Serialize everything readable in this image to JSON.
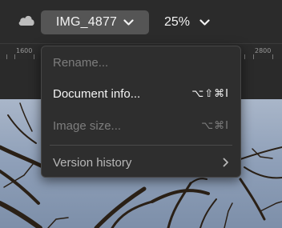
{
  "header": {
    "cloud_icon": "cloud-icon",
    "file_name": "IMG_4877",
    "zoom_level": "25%"
  },
  "ruler": {
    "labels": [
      "1600",
      "2800"
    ]
  },
  "menu": {
    "items": [
      {
        "label": "Rename...",
        "shortcut": "",
        "state": "disabled"
      },
      {
        "label": "Document info...",
        "shortcut": "⌥⇧⌘I",
        "state": "enabled"
      },
      {
        "label": "Image size...",
        "shortcut": "⌥⌘I",
        "state": "disabled"
      },
      {
        "label": "Version history",
        "shortcut": "",
        "state": "submenu"
      }
    ]
  },
  "colors": {
    "toolbar_bg": "#2b2b2b",
    "menu_bg": "#2e2e2e",
    "file_button_bg": "#555555"
  }
}
